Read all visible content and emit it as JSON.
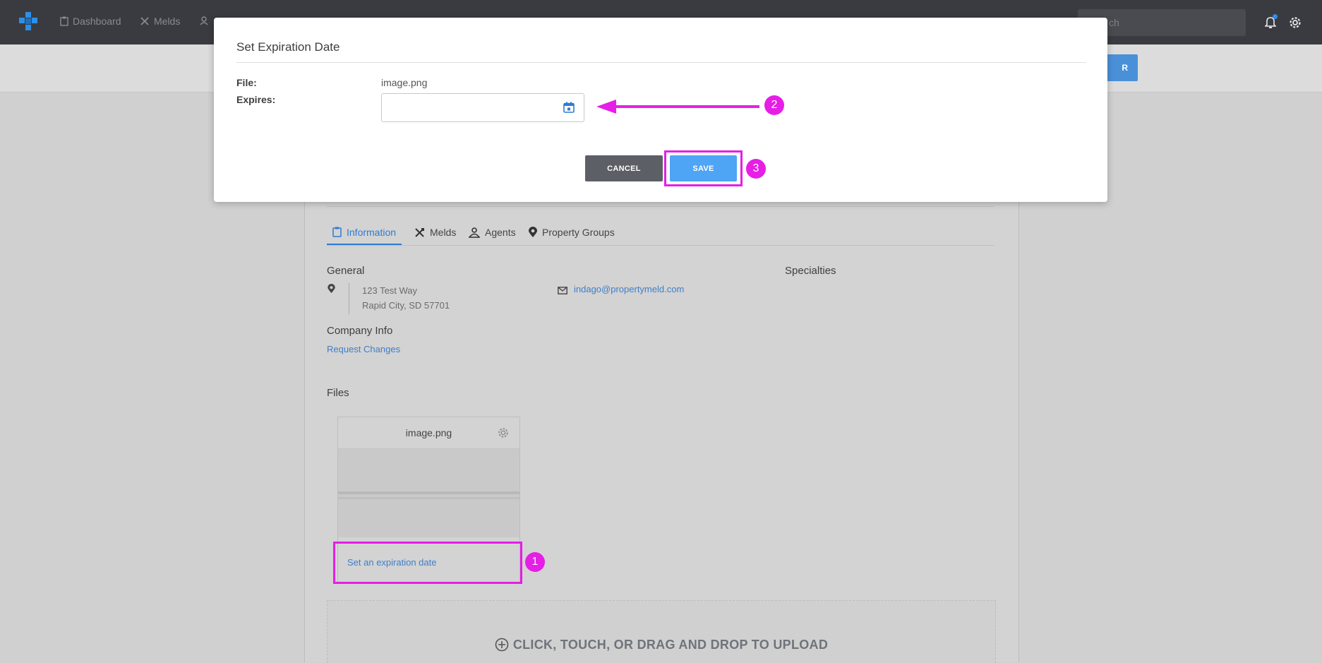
{
  "topnav": {
    "items": [
      {
        "label": "Dashboard",
        "icon": "clipboard-icon"
      },
      {
        "label": "Melds",
        "icon": "tools-icon"
      }
    ],
    "search_placeholder": "Search",
    "search_visible_text": "ch"
  },
  "subbar": {
    "button_label": "R"
  },
  "tabs": [
    {
      "label": "Information",
      "icon": "clipboard-icon",
      "active": true
    },
    {
      "label": "Melds",
      "icon": "tools-icon"
    },
    {
      "label": "Agents",
      "icon": "agents-icon"
    },
    {
      "label": "Property Groups",
      "icon": "location-pin-icon"
    }
  ],
  "general": {
    "heading": "General",
    "address_line1": "123 Test Way",
    "address_line2": "Rapid City, SD 57701",
    "email": "indago@propertymeld.com"
  },
  "specialties": {
    "heading": "Specialties"
  },
  "company_info": {
    "heading": "Company Info",
    "link": "Request Changes"
  },
  "files": {
    "heading": "Files",
    "card": {
      "name": "image.png",
      "link": "Set an expiration date"
    }
  },
  "upload": {
    "label": "CLICK, TOUCH, OR DRAG AND DROP TO UPLOAD"
  },
  "modal": {
    "title": "Set Expiration Date",
    "file_label": "File:",
    "file_value": "image.png",
    "expires_label": "Expires:",
    "expires_value": "",
    "cancel_label": "CANCEL",
    "save_label": "SAVE"
  },
  "annotations": {
    "step1": "1",
    "step2": "2",
    "step3": "3",
    "color": "#e61ee6"
  }
}
